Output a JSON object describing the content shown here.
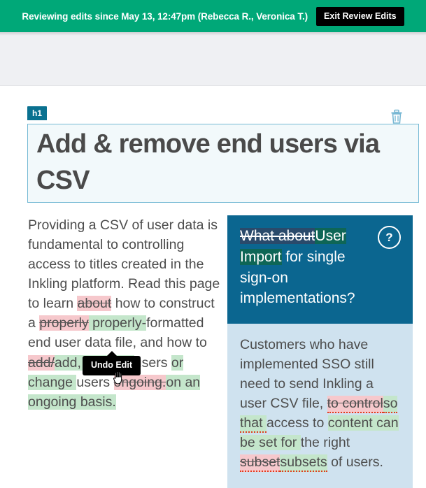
{
  "banner": {
    "message": "Reviewing edits since May 13, 12:47pm (Rebecca R., Veronica T.)",
    "exit_button_label": "Exit Review Edits",
    "background_color": "#00a878",
    "button_background_color": "#000000"
  },
  "heading_block": {
    "tag_label": "h1",
    "tag_color": "#0a7190",
    "text": "Add & remove end users via CSV",
    "border_color": "#74b9d4",
    "fill_color": "#f2f9fb",
    "delete_icon_name": "trash-icon"
  },
  "left_column": {
    "segments": [
      {
        "type": "plain",
        "text": "Providing a CSV of user data is fundamental to controlling access to titles created in the Inkling platform. Read this page to learn "
      },
      {
        "type": "delete",
        "text": "about"
      },
      {
        "type": "plain",
        "text": " how to construct a "
      },
      {
        "type": "delete",
        "text": "properly"
      },
      {
        "type": "insert",
        "text": " properly-"
      },
      {
        "type": "plain",
        "text": "formatted end user data file, and how to "
      },
      {
        "type": "delete",
        "text": "add/"
      },
      {
        "type": "insert",
        "text": "add, remove "
      },
      {
        "type": "plain",
        "text": "users "
      },
      {
        "type": "insert",
        "text": "or change "
      },
      {
        "type": "plain",
        "text": "users "
      },
      {
        "type": "delete",
        "text": "ongoing."
      },
      {
        "type": "insert",
        "text": "on an ongoing basis."
      }
    ]
  },
  "right_panel": {
    "heading_segments": [
      {
        "type": "delete_dark",
        "text": "What about"
      },
      {
        "type": "insert_dark",
        "text": "User Import"
      },
      {
        "type": "plain",
        "text": " for single sign-on implementations?"
      }
    ],
    "help_icon_label": "?",
    "header_background_color": "#0b6690",
    "body_background_color": "#cfe2ef",
    "body_segments": [
      {
        "type": "plain",
        "text": "Customers who have implemented SSO still need to send Inkling a user CSV file, "
      },
      {
        "type": "delete_spell",
        "text": "to control"
      },
      {
        "type": "insert_spell",
        "text": "so that "
      },
      {
        "type": "plain",
        "text": "access to "
      },
      {
        "type": "insert",
        "text": "content can be set for "
      },
      {
        "type": "plain",
        "text": "the right "
      },
      {
        "type": "delete_spell",
        "text": "subset"
      },
      {
        "type": "insert_spell",
        "text": "subsets"
      },
      {
        "type": "plain",
        "text": " of users."
      }
    ]
  },
  "tooltip": {
    "label": "Undo Edit",
    "background_color": "#000000"
  },
  "edit_colors": {
    "deletion_highlight": "#f6c8cc",
    "insertion_highlight": "#c4e6cb",
    "deletion_highlight_dark": "#2a4a6b",
    "insertion_highlight_dark": "#0e6656",
    "spellcheck_underline": "#e03b1e"
  }
}
